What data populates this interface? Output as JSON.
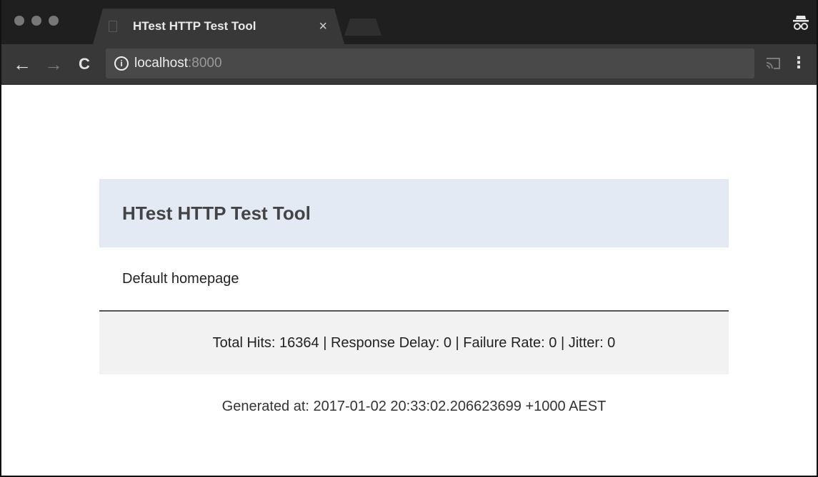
{
  "browser": {
    "tab": {
      "title": "HTest HTTP Test Tool",
      "close_glyph": "×"
    },
    "nav": {
      "back_glyph": "←",
      "forward_glyph": "→",
      "reload_glyph": "C"
    },
    "address_bar": {
      "info_glyph": "i",
      "host": "localhost",
      "port": ":8000"
    },
    "menu_glyph": "⋮",
    "icons": [
      "page-icon",
      "close-icon",
      "incognito-icon",
      "back-arrow-icon",
      "forward-arrow-icon",
      "reload-icon",
      "info-icon",
      "cast-icon",
      "menu-icon"
    ]
  },
  "page": {
    "header_title": "HTest HTTP Test Tool",
    "body_text": "Default homepage",
    "stats_line": "Total Hits: 16364 | Response Delay: 0 | Failure Rate: 0 | Jitter: 0",
    "generated_line": "Generated at: 2017-01-02 20:33:02.206623699 +1000 AEST"
  },
  "colors": {
    "titlebar": "#1f1f1f",
    "tab": "#383838",
    "toolbar": "#383838",
    "omnibox": "#494949",
    "panel_header": "#e3eaf3",
    "stats_bg": "#f2f2f2"
  }
}
